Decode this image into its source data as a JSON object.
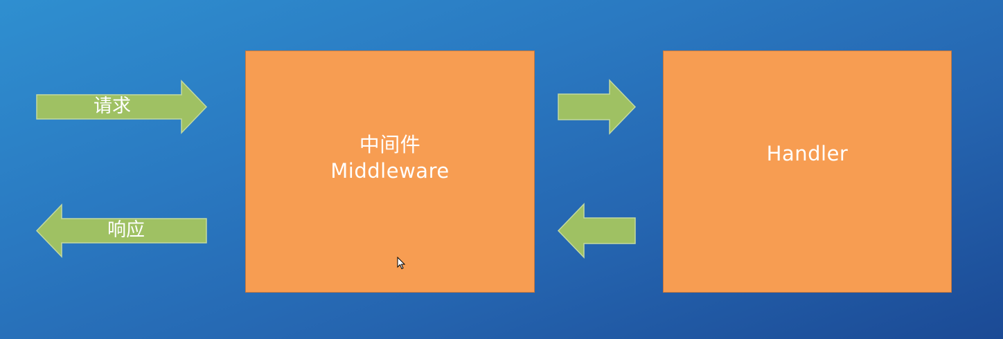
{
  "diagram": {
    "request_label": "请求",
    "response_label": "响应",
    "middleware": {
      "title_cn": "中间件",
      "title_en": "Middleware"
    },
    "handler": {
      "title": "Handler"
    }
  },
  "colors": {
    "background_top": "#2f8fd0",
    "background_bottom": "#1b4a95",
    "box_fill": "#f79d52",
    "arrow_fill": "#9fc163",
    "arrow_stroke": "#c3d9a0",
    "text": "#ffffff"
  },
  "icons": {
    "cursor": "mouse-pointer-icon"
  }
}
